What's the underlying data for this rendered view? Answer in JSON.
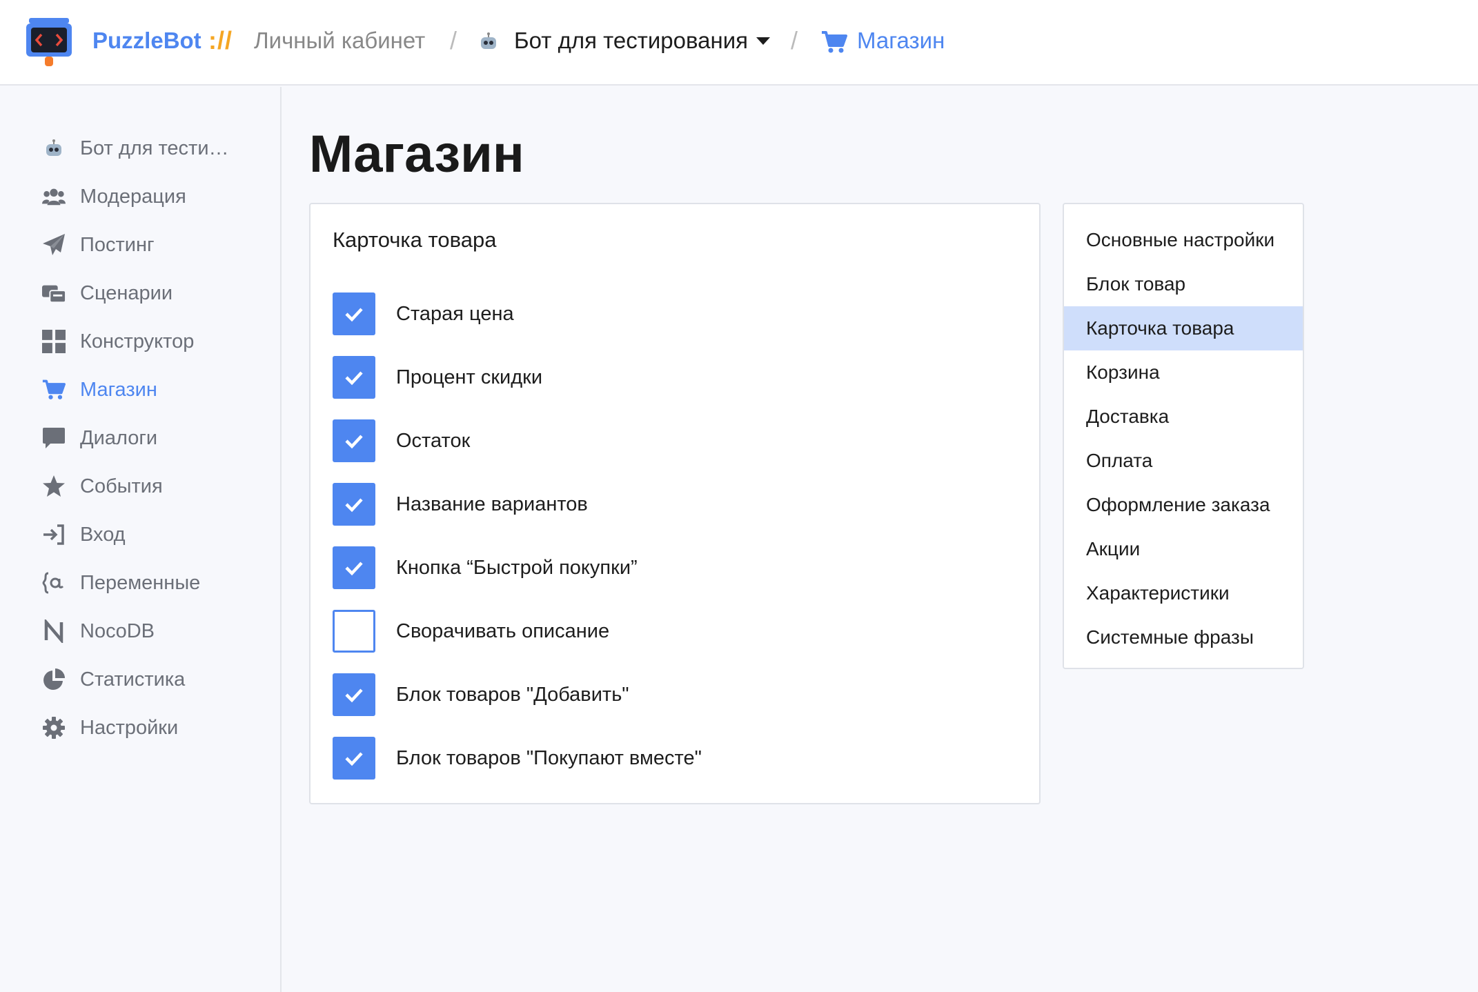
{
  "header": {
    "brand": "PuzzleBot",
    "brand_separator": "://",
    "crumb_cabinet": "Личный кабинет",
    "crumb_bot": "Бот для тестирования",
    "crumb_page": "Магазин"
  },
  "sidebar": {
    "items": [
      {
        "label": "Бот для тести…",
        "icon": "robot-icon"
      },
      {
        "label": "Модерация",
        "icon": "users-icon"
      },
      {
        "label": "Постинг",
        "icon": "paper-plane-icon"
      },
      {
        "label": "Сценарии",
        "icon": "scenarios-icon"
      },
      {
        "label": "Конструктор",
        "icon": "grid-icon"
      },
      {
        "label": "Магазин",
        "icon": "cart-icon",
        "active": true
      },
      {
        "label": "Диалоги",
        "icon": "chat-icon"
      },
      {
        "label": "События",
        "icon": "star-icon"
      },
      {
        "label": "Вход",
        "icon": "sign-in-icon"
      },
      {
        "label": "Переменные",
        "icon": "variables-icon"
      },
      {
        "label": "NocoDB",
        "icon": "nocodb-icon"
      },
      {
        "label": "Статистика",
        "icon": "pie-chart-icon"
      },
      {
        "label": "Настройки",
        "icon": "gear-icon"
      }
    ]
  },
  "main": {
    "title": "Магазин",
    "card": {
      "title": "Карточка товара",
      "options": [
        {
          "label": "Старая цена",
          "checked": true
        },
        {
          "label": "Процент скидки",
          "checked": true
        },
        {
          "label": "Остаток",
          "checked": true
        },
        {
          "label": "Название вариантов",
          "checked": true
        },
        {
          "label": "Кнопка “Быстрой покупки”",
          "checked": true
        },
        {
          "label": "Сворачивать описание",
          "checked": false
        },
        {
          "label": "Блок товаров \"Добавить\"",
          "checked": true
        },
        {
          "label": "Блок товаров \"Покупают вместе\"",
          "checked": true
        }
      ]
    }
  },
  "settings_menu": {
    "items": [
      {
        "label": "Основные настройки"
      },
      {
        "label": "Блок товар"
      },
      {
        "label": "Карточка товара",
        "active": true
      },
      {
        "label": "Корзина"
      },
      {
        "label": "Доставка"
      },
      {
        "label": "Оплата"
      },
      {
        "label": "Оформление заказа"
      },
      {
        "label": "Акции"
      },
      {
        "label": "Характеристики"
      },
      {
        "label": "Системные фразы"
      }
    ]
  },
  "colors": {
    "accent": "#4e86f0",
    "brand_separator": "#f5a623",
    "active_menu_bg": "#cfdefb"
  }
}
